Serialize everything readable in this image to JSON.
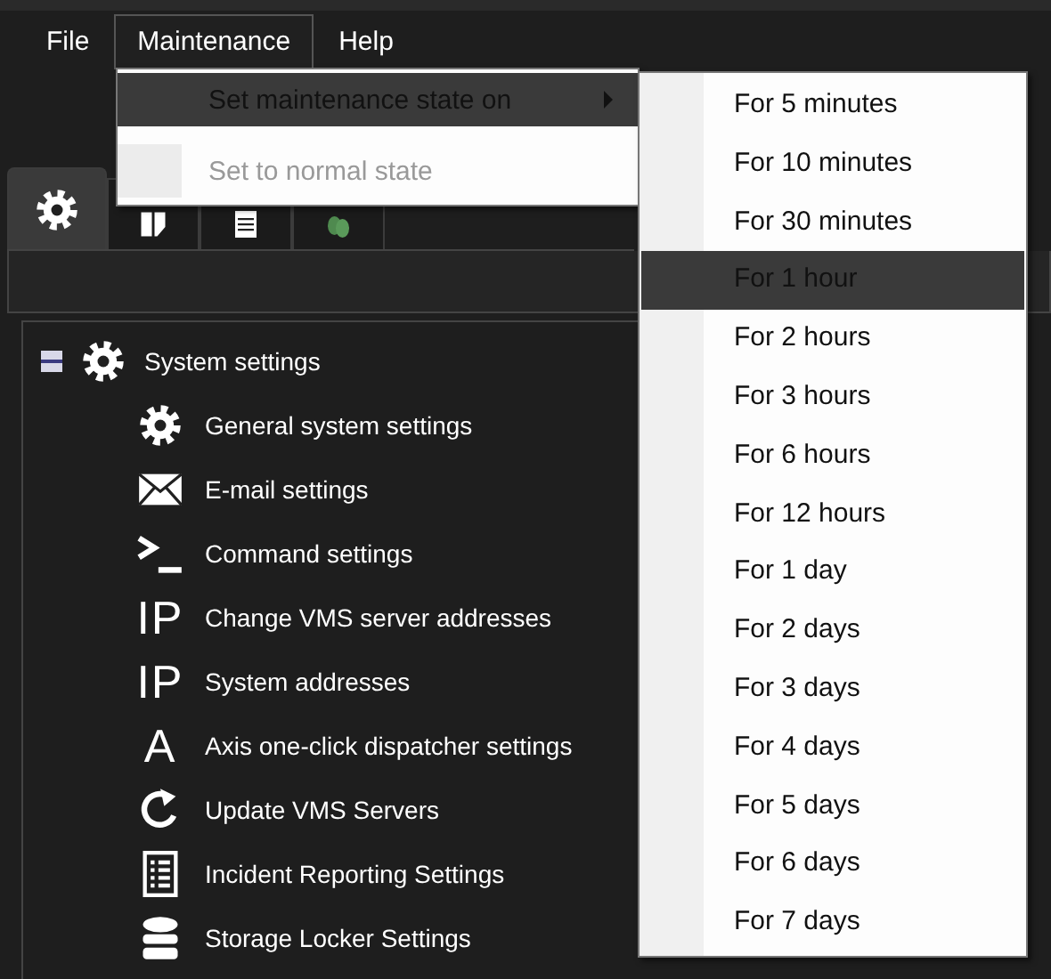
{
  "menu_bar": [
    {
      "label": "File",
      "open": false
    },
    {
      "label": "Maintenance",
      "open": true
    },
    {
      "label": "Help",
      "open": false
    }
  ],
  "maintenance_menu": {
    "items": [
      {
        "label": "Set maintenance state on",
        "selected": true,
        "disabled": false,
        "has_submenu": true
      },
      {
        "label": "Set to normal state",
        "selected": false,
        "disabled": true,
        "has_submenu": false
      }
    ]
  },
  "submenu": {
    "items": [
      {
        "label": "For 5 minutes",
        "selected": false
      },
      {
        "label": "For 10 minutes",
        "selected": false
      },
      {
        "label": "For 30 minutes",
        "selected": false
      },
      {
        "label": "For 1 hour",
        "selected": true
      },
      {
        "label": "For 2 hours",
        "selected": false
      },
      {
        "label": "For 3 hours",
        "selected": false
      },
      {
        "label": "For 6 hours",
        "selected": false
      },
      {
        "label": "For 12 hours",
        "selected": false
      },
      {
        "label": "For 1 day",
        "selected": false
      },
      {
        "label": "For 2 days",
        "selected": false
      },
      {
        "label": "For 3 days",
        "selected": false
      },
      {
        "label": "For 4 days",
        "selected": false
      },
      {
        "label": "For 5 days",
        "selected": false
      },
      {
        "label": "For 6 days",
        "selected": false
      },
      {
        "label": "For 7 days",
        "selected": false
      }
    ]
  },
  "tabs": [
    {
      "kind": "gear",
      "selected": true
    },
    {
      "kind": "book",
      "selected": false
    },
    {
      "kind": "document",
      "selected": false
    },
    {
      "kind": "people",
      "selected": false
    }
  ],
  "tree": {
    "label": "System settings",
    "kind": "gear",
    "expanded": true,
    "children": [
      {
        "label": "General system settings",
        "kind": "gear"
      },
      {
        "label": "E-mail settings",
        "kind": "mail"
      },
      {
        "label": "Command settings",
        "kind": "command"
      },
      {
        "label": "Change VMS server addresses",
        "kind": "glyph",
        "glyph": "IP"
      },
      {
        "label": "System addresses",
        "kind": "glyph",
        "glyph": "IP"
      },
      {
        "label": "Axis one-click dispatcher settings",
        "kind": "glyph",
        "glyph": "A"
      },
      {
        "label": "Update VMS Servers",
        "kind": "refresh"
      },
      {
        "label": "Incident Reporting Settings",
        "kind": "list"
      },
      {
        "label": "Storage Locker Settings",
        "kind": "database"
      }
    ]
  }
}
